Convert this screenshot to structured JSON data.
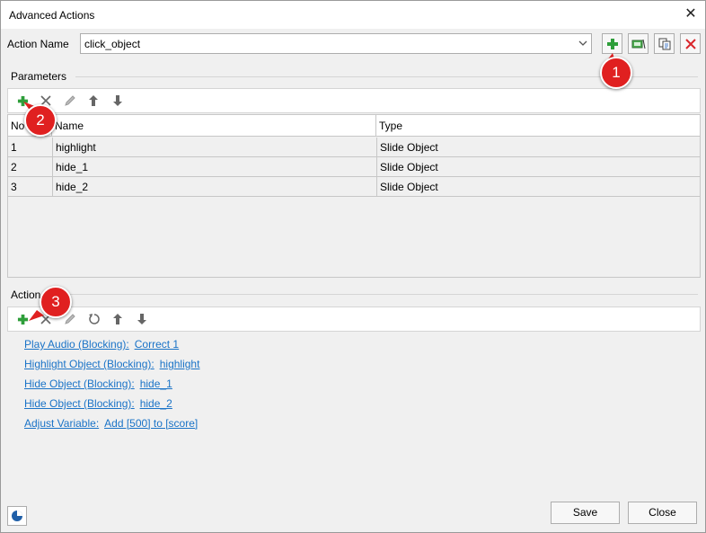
{
  "window": {
    "title": "Advanced Actions"
  },
  "action_name": {
    "label": "Action Name",
    "value": "click_object"
  },
  "parameters": {
    "section_label": "Parameters",
    "columns": [
      "No",
      "Name",
      "Type"
    ],
    "rows": [
      {
        "no": "1",
        "name": "highlight",
        "type": "Slide Object"
      },
      {
        "no": "2",
        "name": "hide_1",
        "type": "Slide Object"
      },
      {
        "no": "3",
        "name": "hide_2",
        "type": "Slide Object"
      }
    ]
  },
  "actions": {
    "section_label": "Action",
    "items": [
      {
        "action": "Play Audio (Blocking):",
        "arg": "Correct 1"
      },
      {
        "action": "Highlight Object (Blocking):",
        "arg": "highlight"
      },
      {
        "action": "Hide Object (Blocking):",
        "arg": "hide_1"
      },
      {
        "action": "Hide Object (Blocking):",
        "arg": "hide_2"
      },
      {
        "action": "Adjust Variable:",
        "arg": "Add [500] to [score]"
      }
    ]
  },
  "badges": [
    "1",
    "2",
    "3"
  ],
  "footer": {
    "save_label": "Save",
    "close_label": "Close"
  },
  "colors": {
    "link": "#1a73c7",
    "add_green": "#2e9e3a",
    "delete_red": "#d9262b",
    "badge_red": "#e02020"
  }
}
